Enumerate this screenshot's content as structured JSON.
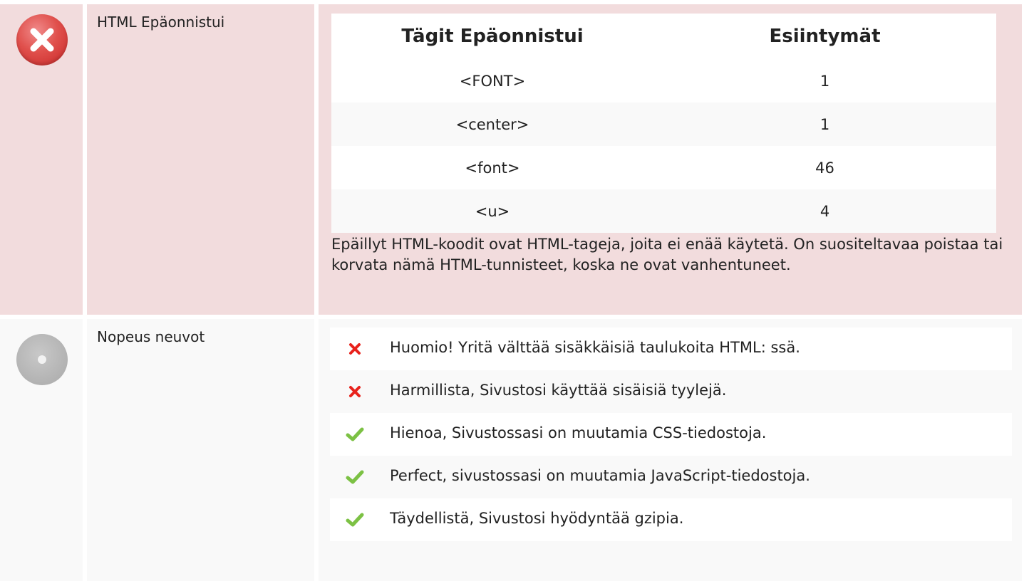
{
  "html_failed": {
    "label": "HTML Epäonnistui",
    "status_icon": "error-icon",
    "table": {
      "headers": [
        "Tägit Epäonnistui",
        "Esiintymät"
      ],
      "rows": [
        {
          "tag": "<FONT>",
          "count": "1"
        },
        {
          "tag": "<center>",
          "count": "1"
        },
        {
          "tag": "<font>",
          "count": "46"
        },
        {
          "tag": "<u>",
          "count": "4"
        }
      ]
    },
    "description": "Epäillyt HTML-koodit ovat HTML-tageja, joita ei enää käytetä. On suositeltavaa poistaa tai korvata nämä HTML-tunnisteet, koska ne ovat vanhentuneet."
  },
  "speed_tips": {
    "label": "Nopeus neuvot",
    "status_icon": "neutral-icon",
    "items": [
      {
        "status": "fail",
        "icon": "red-x-icon",
        "text": "Huomio! Yritä välttää sisäkkäisiä taulukoita HTML: ssä."
      },
      {
        "status": "fail",
        "icon": "red-x-icon",
        "text": "Harmillista, Sivustosi käyttää sisäisiä tyylejä."
      },
      {
        "status": "pass",
        "icon": "green-check-icon",
        "text": "Hienoa, Sivustossasi on muutamia CSS-tiedostoja."
      },
      {
        "status": "pass",
        "icon": "green-check-icon",
        "text": "Perfect, sivustossasi on muutamia JavaScript-tiedostoja."
      },
      {
        "status": "pass",
        "icon": "green-check-icon",
        "text": "Täydellistä, Sivustosi hyödyntää gzipia."
      }
    ]
  },
  "colors": {
    "fail_row_bg": "#f2dcdd",
    "neutral_row_bg": "#f9f9f9",
    "error_red": "#e0504c",
    "check_green": "#7cc144",
    "x_red": "#e8221c"
  }
}
